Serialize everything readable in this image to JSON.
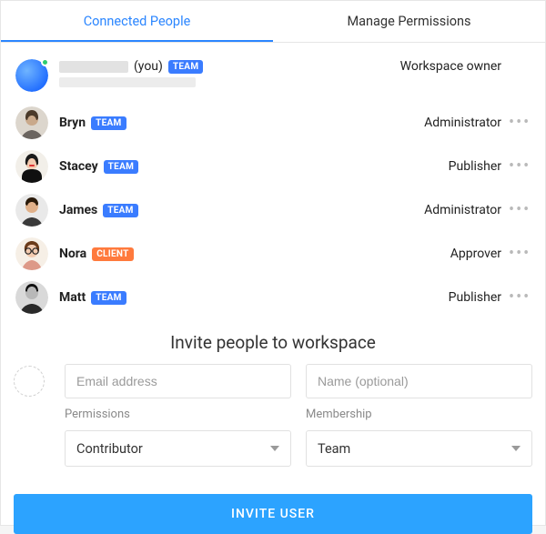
{
  "tabs": {
    "connected": "Connected People",
    "permissions": "Manage Permissions"
  },
  "people": [
    {
      "name": "",
      "you_suffix": "(you)",
      "badge": "TEAM",
      "badge_kind": "team",
      "role": "Workspace owner",
      "has_menu": false,
      "redacted": true,
      "presence": true
    },
    {
      "name": "Bryn",
      "badge": "TEAM",
      "badge_kind": "team",
      "role": "Administrator",
      "has_menu": true
    },
    {
      "name": "Stacey",
      "badge": "TEAM",
      "badge_kind": "team",
      "role": "Publisher",
      "has_menu": true
    },
    {
      "name": "James",
      "badge": "TEAM",
      "badge_kind": "team",
      "role": "Administrator",
      "has_menu": true
    },
    {
      "name": "Nora",
      "badge": "CLIENT",
      "badge_kind": "client",
      "role": "Approver",
      "has_menu": true
    },
    {
      "name": "Matt",
      "badge": "TEAM",
      "badge_kind": "team",
      "role": "Publisher",
      "has_menu": true
    }
  ],
  "invite": {
    "title": "Invite people to workspace",
    "email_placeholder": "Email address",
    "name_placeholder": "Name (optional)",
    "permissions_label": "Permissions",
    "permissions_value": "Contributor",
    "membership_label": "Membership",
    "membership_value": "Team",
    "button": "INVITE USER"
  },
  "avatar_svgs": {
    "self": "<svg viewBox='0 0 36 36'><defs><radialGradient id='g0' cx='35%' cy='35%' r='70%'><stop offset='0%' stop-color='#6fb4ff'/><stop offset='100%' stop-color='#1e6bff'/></radialGradient></defs><circle cx='18' cy='18' r='18' fill='url(#g0)'/></svg>",
    "bryn": "<svg viewBox='0 0 36 36'><circle cx='18' cy='18' r='18' fill='#dcd6cd'/><circle cx='18' cy='14' r='7' fill='#c9a98b'/><path d='M6 36c2-8 10-10 12-10s10 2 12 10z' fill='#6b6560'/><path d='M11 12c0-5 3-8 7-8s7 3 7 8c0 2-1 3-2 3-1-4-3-5-5-5s-4 1-5 5c-1 0-2-1-2-3z' fill='#4a3a2a'/></svg>",
    "stacey": "<svg viewBox='0 0 36 36'><circle cx='18' cy='18' r='18' fill='#f2efe9'/><path d='M7 30c0-7 5-9 11-9s11 2 11 9v6H7z' fill='#101010'/><circle cx='18' cy='14' r='7' fill='#f3cbb0'/><path d='M11 15c-1-8 4-11 7-11s8 3 7 11c-1 2-2 2-2 0-1-5-3-6-5-6s-4 1-5 6c0 2-1 2-2 0z' fill='#1a1a1a'/><rect x='15' y='16' width='6' height='2' rx='1' fill='#d33'/></svg>",
    "james": "<svg viewBox='0 0 36 36'><circle cx='18' cy='18' r='18' fill='#e9e9e9'/><circle cx='18' cy='14' r='7' fill='#e0b089'/><path d='M6 36c2-8 9-10 12-10s10 2 12 10z' fill='#3a3a3a'/><path d='M11 11c0-4 3-7 7-7s7 3 7 7c0 1-1 2-2 2-1-3-3-4-5-4s-4 1-5 4c-1 0-2-1-2-2z' fill='#2a1a0a'/></svg>",
    "nora": "<svg viewBox='0 0 36 36'><circle cx='18' cy='18' r='18' fill='#f6efe6'/><circle cx='18' cy='15' r='7' fill='#f3cbb0'/><path d='M7 36c2-9 9-11 11-11s9 2 11 11z' fill='#d98'/><path d='M10 14c-1-7 4-10 8-10s9 3 8 10c0 2-1 2-2 0-1-5-3-6-6-6s-5 1-6 6c-1 2-2 2-2 0z' fill='#6b3b1a'/><circle cx='14' cy='15' r='3.2' fill='none' stroke='#222' stroke-width='1.2'/><circle cx='22' cy='15' r='3.2' fill='none' stroke='#222' stroke-width='1.2'/><line x1='17' y1='15' x2='19' y2='15' stroke='#222' stroke-width='1.2'/></svg>",
    "matt": "<svg viewBox='0 0 36 36'><circle cx='18' cy='18' r='18' fill='#d9d9d9'/><circle cx='18' cy='13' r='7' fill='#b8b8b8'/><path d='M5 36c2-9 10-11 13-11s11 2 13 11z' fill='#2a2a2a'/><path d='M11 11c0-5 3-8 7-8s7 3 7 8c-1 1-2 1-2-1-1-3-3-4-5-4s-4 1-5 4c0 2-1 2-2 1z' fill='#111'/></svg>"
  },
  "avatar_order": [
    "self",
    "bryn",
    "stacey",
    "james",
    "nora",
    "matt"
  ]
}
